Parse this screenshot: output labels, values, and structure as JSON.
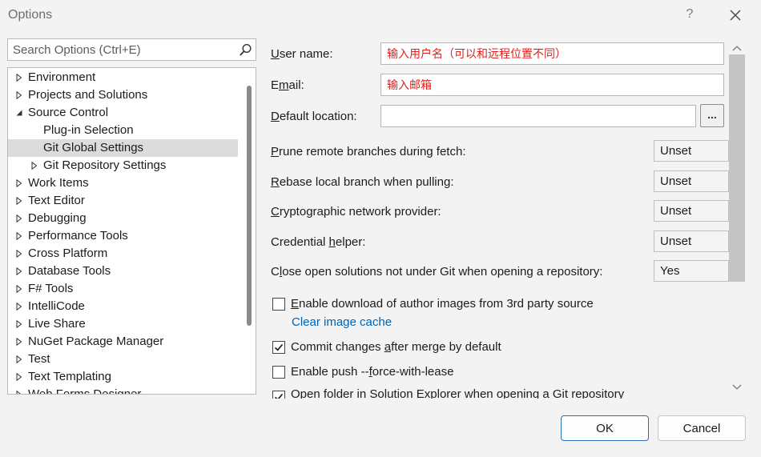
{
  "window": {
    "title": "Options",
    "help_glyph": "?",
    "close_icon": "close-icon"
  },
  "search": {
    "placeholder": "Search Options (Ctrl+E)",
    "icon": "search-icon"
  },
  "tree": {
    "items": [
      {
        "label": "Environment",
        "level": 0,
        "state": "collapsed"
      },
      {
        "label": "Projects and Solutions",
        "level": 0,
        "state": "collapsed"
      },
      {
        "label": "Source Control",
        "level": 0,
        "state": "expanded"
      },
      {
        "label": "Plug-in Selection",
        "level": 1,
        "state": "leaf"
      },
      {
        "label": "Git Global Settings",
        "level": 1,
        "state": "leaf",
        "selected": true
      },
      {
        "label": "Git Repository Settings",
        "level": 1,
        "state": "collapsed"
      },
      {
        "label": "Work Items",
        "level": 0,
        "state": "collapsed"
      },
      {
        "label": "Text Editor",
        "level": 0,
        "state": "collapsed"
      },
      {
        "label": "Debugging",
        "level": 0,
        "state": "collapsed"
      },
      {
        "label": "Performance Tools",
        "level": 0,
        "state": "collapsed"
      },
      {
        "label": "Cross Platform",
        "level": 0,
        "state": "collapsed"
      },
      {
        "label": "Database Tools",
        "level": 0,
        "state": "collapsed"
      },
      {
        "label": "F# Tools",
        "level": 0,
        "state": "collapsed"
      },
      {
        "label": "IntelliCode",
        "level": 0,
        "state": "collapsed"
      },
      {
        "label": "Live Share",
        "level": 0,
        "state": "collapsed"
      },
      {
        "label": "NuGet Package Manager",
        "level": 0,
        "state": "collapsed"
      },
      {
        "label": "Test",
        "level": 0,
        "state": "collapsed"
      },
      {
        "label": "Text Templating",
        "level": 0,
        "state": "collapsed"
      },
      {
        "label": "Web Forms Designer",
        "level": 0,
        "state": "collapsed"
      }
    ]
  },
  "settings": {
    "user_name": {
      "pre": "",
      "key": "U",
      "post": "ser name:",
      "value": "输入用户名（可以和远程位置不同）"
    },
    "email": {
      "pre": "E",
      "key": "m",
      "post": "ail:",
      "value": "输入邮箱"
    },
    "default_location": {
      "pre": "",
      "key": "D",
      "post": "efault location:",
      "value": "",
      "browse_label": "..."
    },
    "dropdowns": [
      {
        "pre": "",
        "key": "P",
        "post": "rune remote branches during fetch:",
        "value": "Unset"
      },
      {
        "pre": "",
        "key": "R",
        "post": "ebase local branch when pulling:",
        "value": "Unset"
      },
      {
        "pre": "",
        "key": "C",
        "post": "ryptographic network provider:",
        "value": "Unset"
      },
      {
        "pre": "Credential ",
        "key": "h",
        "post": "elper:",
        "value": "Unset"
      },
      {
        "pre": "C",
        "key": "l",
        "post": "ose open solutions not under Git when opening a repository:",
        "value": "Yes"
      }
    ],
    "enable_author_images": {
      "pre": "",
      "key": "E",
      "post": "nable download of author images from 3rd party source",
      "checked": false
    },
    "clear_cache_link": "Clear image cache",
    "commit_after_merge": {
      "pre": "Commit changes ",
      "key": "a",
      "post": "fter merge by default",
      "checked": true
    },
    "push_force": {
      "pre": "Enable push --",
      "key": "f",
      "post": "orce-with-lease",
      "checked": false
    },
    "open_folder_partial": {
      "label": "Open folder in Solution Explorer when opening a Git repository",
      "checked": true
    }
  },
  "buttons": {
    "ok": "OK",
    "cancel": "Cancel"
  },
  "colors": {
    "accent": "#0063b1",
    "value_text": "#e0201c",
    "selected_row": "#dcdcdc"
  }
}
